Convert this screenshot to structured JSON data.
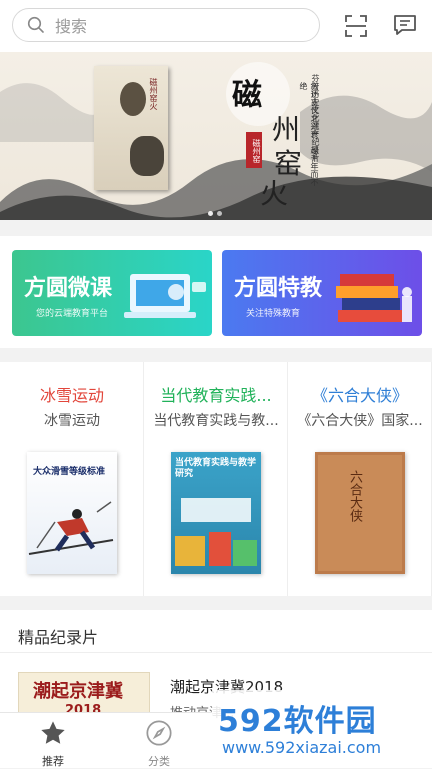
{
  "search": {
    "placeholder": "搜索"
  },
  "banner": {
    "title_chars": [
      "磁",
      "州",
      "窑",
      "火"
    ],
    "book_title": "磁州窑火",
    "seal": "磁州窑",
    "vertical_text": [
      "芬芳历史文化遗产纪录片",
      "叙述古代之兴衰，越千年而不绝"
    ]
  },
  "promo": [
    {
      "title": "方圆微课",
      "subtitle": "您的云端教育平台"
    },
    {
      "title": "方圆特教",
      "subtitle": "关注特殊教育"
    }
  ],
  "columns": [
    {
      "heading": "冰雪运动",
      "sub": "冰雪运动",
      "color": "#e2463b",
      "cover_text": "大众滑雪等级标准"
    },
    {
      "heading": "当代教育实践...",
      "sub": "当代教育实践与教...",
      "color": "#21b25a",
      "cover_text": "当代教育实践与教学研究"
    },
    {
      "heading": "《六合大侠》",
      "sub": "《六合大侠》国家...",
      "color": "#2f7fd6",
      "cover_text": "六合大侠"
    }
  ],
  "section": {
    "title": "精品纪录片",
    "item": {
      "title": "潮起京津冀2018",
      "subtitle": "推动京津...",
      "thumb_text": "潮起京津冀",
      "thumb_year": "2018"
    }
  },
  "tabs": [
    {
      "label": "推荐",
      "icon": "star-icon"
    },
    {
      "label": "分类",
      "icon": "compass-icon"
    }
  ],
  "watermark": {
    "brand": "592软件园",
    "url": "www.592xiazai.com"
  }
}
